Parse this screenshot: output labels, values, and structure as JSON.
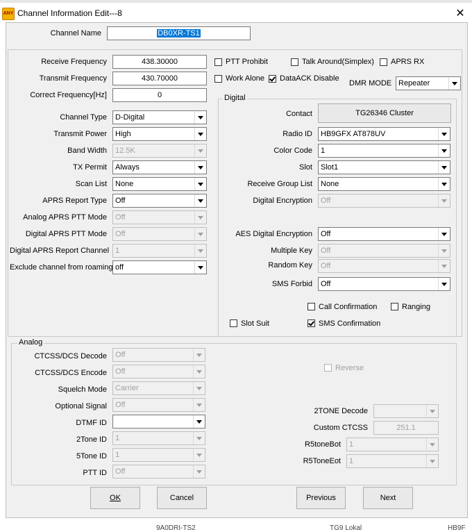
{
  "window": {
    "title": "Channel Information Edit---8",
    "icon_text": "ANY"
  },
  "background": {
    "top_fragment_1": "... ",
    "bottom_fragment_1": "9A0DRI-TS2",
    "bottom_fragment_2": "TG9 Lokal",
    "bottom_fragment_3": "HB9F"
  },
  "channel_name": {
    "label": "Channel Name",
    "value": "DB0XR-TS1"
  },
  "freq": {
    "rx_label": "Receive Frequency",
    "rx_value": "438.30000",
    "tx_label": "Transmit Frequency",
    "tx_value": "430.70000",
    "corr_label": "Correct Frequency[Hz]",
    "corr_value": "0"
  },
  "checks": {
    "ptt_prohibit": "PTT Prohibit",
    "talk_around": "Talk Around(Simplex)",
    "aprs_rx": "APRS RX",
    "work_alone": "Work Alone",
    "dataack_disable": "DataACK Disable"
  },
  "dmr_mode": {
    "label": "DMR MODE",
    "value": "Repeater"
  },
  "left": {
    "channel_type": {
      "label": "Channel Type",
      "value": "D-Digital"
    },
    "transmit_power": {
      "label": "Transmit Power",
      "value": "High"
    },
    "band_width": {
      "label": "Band Width",
      "value": "12.5K"
    },
    "tx_permit": {
      "label": "TX Permit",
      "value": "Always"
    },
    "scan_list": {
      "label": "Scan List",
      "value": "None"
    },
    "aprs_report_type": {
      "label": "APRS Report Type",
      "value": "Off"
    },
    "analog_aprs_ptt": {
      "label": "Analog APRS PTT Mode",
      "value": "Off"
    },
    "digital_aprs_ptt": {
      "label": "Digital APRS PTT Mode",
      "value": "Off"
    },
    "digital_aprs_channel": {
      "label": "Digital APRS Report Channel",
      "value": "1"
    },
    "exclude_roaming": {
      "label": "Exclude channel from roaming",
      "value": "off"
    }
  },
  "digital": {
    "group_title": "Digital",
    "contact": {
      "label": "Contact",
      "value": "TG26346 Cluster"
    },
    "radio_id": {
      "label": "Radio ID",
      "value": "HB9GFX AT878UV"
    },
    "color_code": {
      "label": "Color Code",
      "value": "1"
    },
    "slot": {
      "label": "Slot",
      "value": "Slot1"
    },
    "rx_group": {
      "label": "Receive Group List",
      "value": "None"
    },
    "digital_encryption": {
      "label": "Digital Encryption",
      "value": "Off"
    },
    "aes_encryption": {
      "label": "AES Digital Encryption",
      "value": "Off"
    },
    "multiple_key": {
      "label": "Multiple Key",
      "value": "Off"
    },
    "random_key": {
      "label": "Random Key",
      "value": "Off"
    },
    "sms_forbid": {
      "label": "SMS Forbid",
      "value": "Off"
    },
    "call_confirmation": "Call Confirmation",
    "ranging": "Ranging",
    "slot_suit": "Slot Suit",
    "sms_confirmation": "SMS Confirmation"
  },
  "analog": {
    "group_title": "Analog",
    "ctcss_decode": {
      "label": "CTCSS/DCS Decode",
      "value": "Off"
    },
    "ctcss_encode": {
      "label": "CTCSS/DCS Encode",
      "value": "Off"
    },
    "squelch_mode": {
      "label": "Squelch Mode",
      "value": "Carrier"
    },
    "optional_signal": {
      "label": "Optional Signal",
      "value": "Off"
    },
    "dtmf_id": {
      "label": "DTMF ID",
      "value": ""
    },
    "two_tone_id": {
      "label": "2Tone ID",
      "value": "1"
    },
    "five_tone_id": {
      "label": "5Tone ID",
      "value": "1"
    },
    "ptt_id": {
      "label": "PTT ID",
      "value": "Off"
    },
    "reverse": "Reverse",
    "two_tone_decode": {
      "label": "2TONE Decode",
      "value": ""
    },
    "custom_ctcss": {
      "label": "Custom CTCSS",
      "value": "251.1"
    },
    "r5tone_bot": {
      "label": "R5toneBot",
      "value": "1"
    },
    "r5tone_eot": {
      "label": "R5ToneEot",
      "value": "1"
    }
  },
  "buttons": {
    "ok": "OK",
    "cancel": "Cancel",
    "previous": "Previous",
    "next": "Next"
  }
}
